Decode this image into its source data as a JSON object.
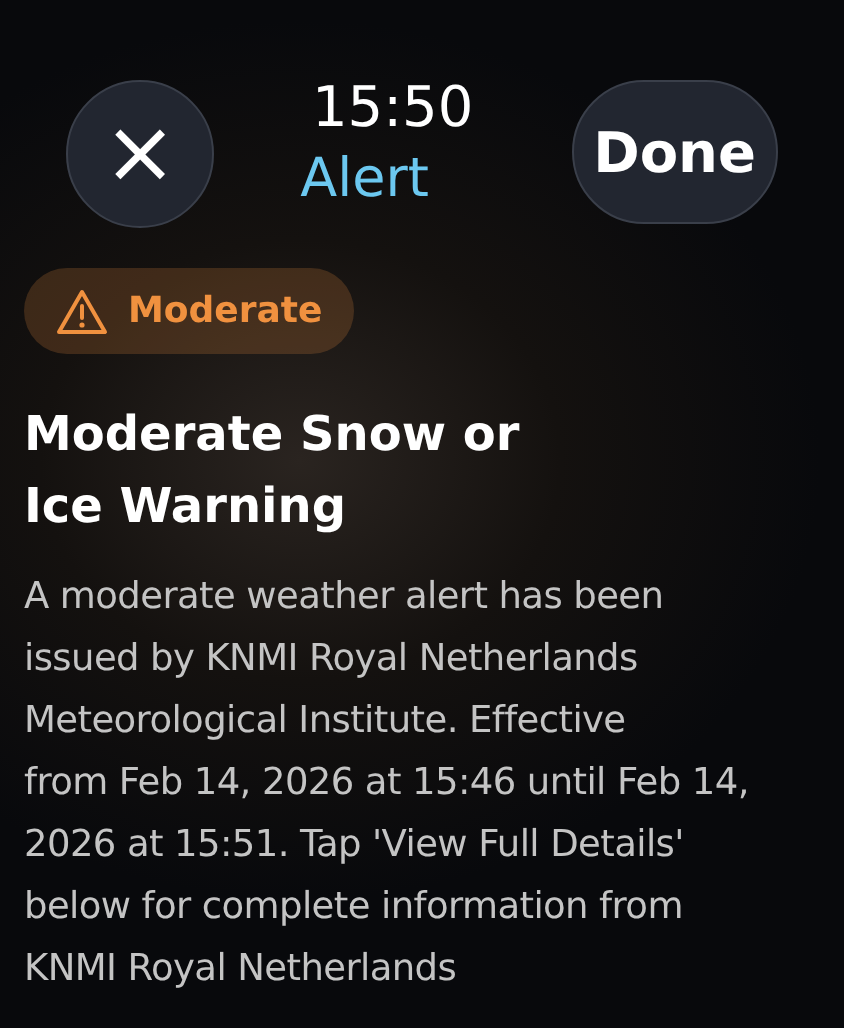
{
  "header": {
    "time": "15:50",
    "title": "Alert",
    "close_label": "×",
    "done_label": "Done"
  },
  "severity": {
    "label": "Moderate",
    "color": "#f0913f"
  },
  "headline": "Moderate Snow or Ice Warning",
  "description_lines": [
    "A moderate weather alert has been",
    "issued by KNMI Royal Netherlands",
    "Meteorological Institute. Effective",
    "from Feb 14, 2026 at 15:46 until Feb 14,",
    "2026 at 15:51. Tap 'View Full Details'",
    "below for complete information from",
    "KNMI Royal Netherlands"
  ]
}
